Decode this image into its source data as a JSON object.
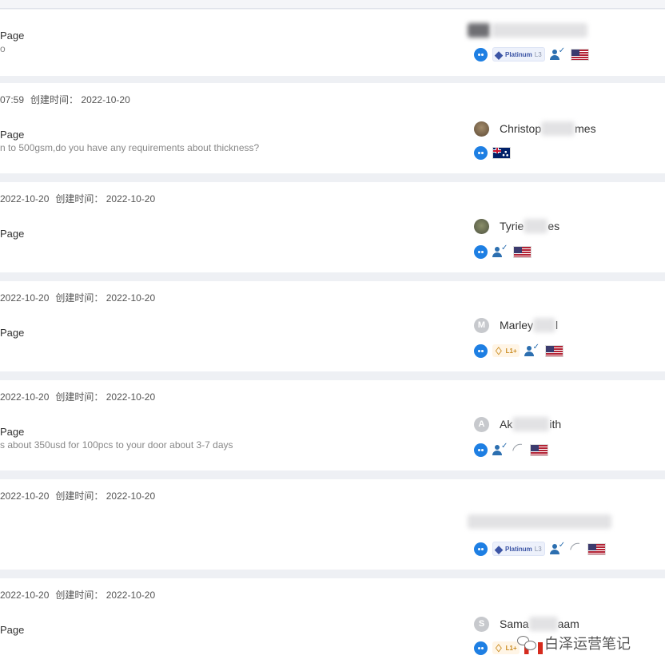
{
  "labels": {
    "created": "创建时间："
  },
  "cards": [
    {
      "title": "Page",
      "snippet": "o",
      "icons": {
        "badge": "Platinum",
        "badge_level": "L3",
        "verified": true,
        "flag": "US"
      }
    },
    {
      "time": "07:59",
      "created": "2022-10-20",
      "title": "Page",
      "snippet": "n to 500gsm,do you have any requirements about thickness?",
      "user": {
        "name_start": "Christop",
        "name_end": "mes"
      },
      "icons": {
        "flag": "AU"
      }
    },
    {
      "time": "2022-10-20",
      "created": "2022-10-20",
      "title": "Page",
      "user": {
        "name_start": "Tyrie",
        "name_end": "es"
      },
      "icons": {
        "verified": true,
        "flag": "US"
      }
    },
    {
      "time": "2022-10-20",
      "created": "2022-10-20",
      "title": "Page",
      "user": {
        "initial": "M",
        "name_start": "Marley",
        "name_end": "l"
      },
      "icons": {
        "badge_level": "L1+",
        "verified": true,
        "flag": "US"
      }
    },
    {
      "time": "2022-10-20",
      "created": "2022-10-20",
      "title": "Page",
      "snippet": "s about 350usd for 100pcs to your door about 3-7 days",
      "user": {
        "initial": "A",
        "name_start": "Ak",
        "name_end": "ith"
      },
      "icons": {
        "verified": true,
        "attachment": true,
        "flag": "US"
      }
    },
    {
      "time": "2022-10-20",
      "created": "2022-10-20",
      "icons": {
        "badge": "Platinum",
        "badge_level": "L3",
        "verified": true,
        "attachment": true,
        "flag": "US"
      }
    },
    {
      "time": "2022-10-20",
      "created": "2022-10-20",
      "title": "Page",
      "user": {
        "initial": "S",
        "name_start": "Sama",
        "name_end": "aam"
      },
      "icons": {
        "badge_level": "L1+",
        "flag": "CA"
      }
    }
  ],
  "watermark": {
    "text": "白泽运营笔记"
  },
  "icon_names": [
    "chat-icon",
    "diamond-badge-icon",
    "verified-buyer-icon",
    "paperclip-icon",
    "wechat-icon"
  ],
  "colors": {
    "accent": "#1e7fe3",
    "badge_blue": "#3c55a5",
    "badge_gold": "#c98a1d"
  }
}
